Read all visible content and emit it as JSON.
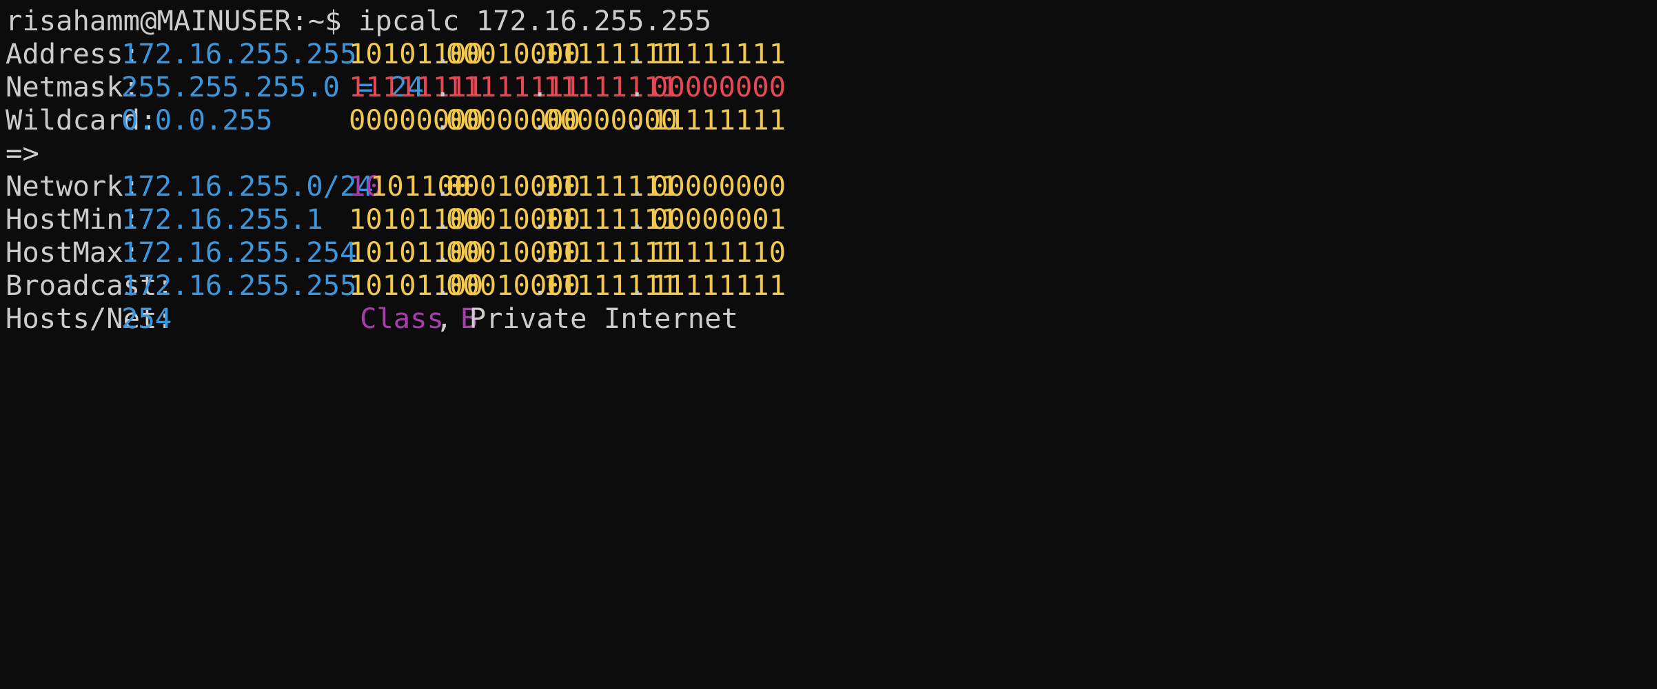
{
  "colors": {
    "background": "#0c0c0c",
    "foreground": "#cccccc",
    "value_blue": "#3a96dd",
    "binary_yellow": "#f2c94c",
    "netmask_red": "#e74856",
    "class_purple": "#a53dab"
  },
  "prompt": {
    "text": "risahamm@MAINUSER:~$ ipcalc 172.16.255.255"
  },
  "rows": [
    {
      "key": "address",
      "label": "Address:",
      "value": "172.16.255.255",
      "bin_o1": "10101100",
      "bin_o2": "00010000",
      "bin_o3": "11111111",
      "bin_o4": "11111111",
      "color": "yellow"
    },
    {
      "key": "netmask",
      "label": "Netmask:",
      "value": "255.255.255.0 = 24",
      "bin_o1": "11111111",
      "bin_o2": "11111111",
      "bin_o3": "11111111",
      "bin_o4": "00000000",
      "color": "red"
    },
    {
      "key": "wildcard",
      "label": "Wildcard:",
      "value": "0.0.0.255",
      "bin_o1": "00000000",
      "bin_o2": "00000000",
      "bin_o3": "00000000",
      "bin_o4": "11111111",
      "color": "yellow"
    }
  ],
  "arrow": "=>",
  "network": {
    "label": "Network:",
    "value": "172.16.255.0/24",
    "bin_class_bits": "10",
    "bin_o1_rest": "101100",
    "bin_o2": "00010000",
    "bin_o3": "11111111",
    "bin_o4": "00000000"
  },
  "rows2": [
    {
      "key": "hostmin",
      "label": "HostMin:",
      "value": "172.16.255.1",
      "bin_o1": "10101100",
      "bin_o2": "00010000",
      "bin_o3": "11111111",
      "bin_o4": "00000001"
    },
    {
      "key": "hostmax",
      "label": "HostMax:",
      "value": "172.16.255.254",
      "bin_o1": "10101100",
      "bin_o2": "00010000",
      "bin_o3": "11111111",
      "bin_o4": "11111110"
    },
    {
      "key": "broadcast",
      "label": "Broadcast:",
      "value": "172.16.255.255",
      "bin_o1": "10101100",
      "bin_o2": "00010000",
      "bin_o3": "11111111",
      "bin_o4": "11111111"
    }
  ],
  "hosts": {
    "label": "Hosts/Net:",
    "value": "254",
    "class_text": "Class B",
    "rest_text": ", Private Internet"
  }
}
